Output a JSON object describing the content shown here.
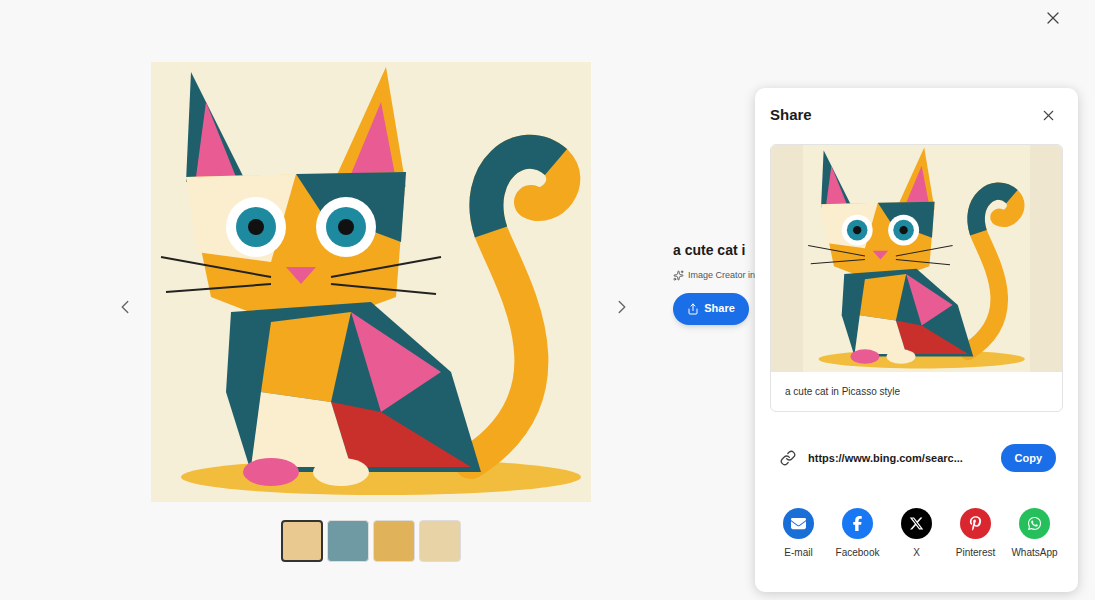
{
  "gallery": {
    "thumbnails": [
      {
        "selected": true
      },
      {
        "selected": false
      },
      {
        "selected": false
      },
      {
        "selected": false
      }
    ]
  },
  "details": {
    "title": "a cute cat i",
    "source": "Image Creator in",
    "share_button": "Share"
  },
  "share_panel": {
    "title": "Share",
    "caption": "a cute cat in Picasso style",
    "link": "https://www.bing.com/searc...",
    "copy_button": "Copy",
    "targets": [
      {
        "label": "E-mail",
        "kind": "email",
        "color": "#1a6fd6"
      },
      {
        "label": "Facebook",
        "kind": "facebook",
        "color": "#1877f2"
      },
      {
        "label": "X",
        "kind": "x",
        "color": "#000000"
      },
      {
        "label": "Pinterest",
        "kind": "pinterest",
        "color": "#d9262f"
      },
      {
        "label": "WhatsApp",
        "kind": "whatsapp",
        "color": "#25c05c"
      }
    ]
  }
}
